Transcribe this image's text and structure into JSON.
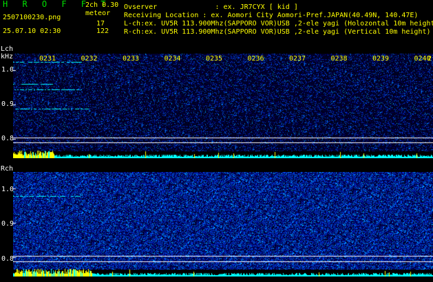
{
  "header": {
    "logo": "H R O F F T",
    "version": "2ch 0.30",
    "filename": "2507100230.png",
    "mode_label": "meteor",
    "timestamp": "25.07.10 02:30",
    "count_l": "17",
    "count_r": "122",
    "observer": "Ovserver              : ex. JR7CYX [ kid ]",
    "location": "Receiving Location : ex. Aomori City Aomori-Pref.JAPAN(40.49N, 140.47E)",
    "lch_line": "L-ch:ex. UV5R 113.900Mhz(SAPPORO VOR)USB ,2-ele yagi (Holozontal 10m height",
    "rch_line": "R-ch:ex. UV5R 113.900Mhz(SAPPORO VOR)USB ,2-ele yagi (Vertical 10m height)"
  },
  "channels": {
    "left_label": "Lch",
    "unit_label": "kHz",
    "right_label": "Rch"
  },
  "time_ticks": [
    "0231",
    "0232",
    "0233",
    "0234",
    "0235",
    "0236",
    "0237",
    "0238",
    "0239",
    "0240",
    "2"
  ],
  "y_ticks": [
    "1.0",
    "0.9",
    "0.8"
  ],
  "colors": {
    "background": "#000000",
    "label": "#ffff00",
    "text": "#ffffff",
    "logo": "#00e000",
    "power_bar": "#00ffff",
    "meteor_bar": "#ffff00"
  }
}
